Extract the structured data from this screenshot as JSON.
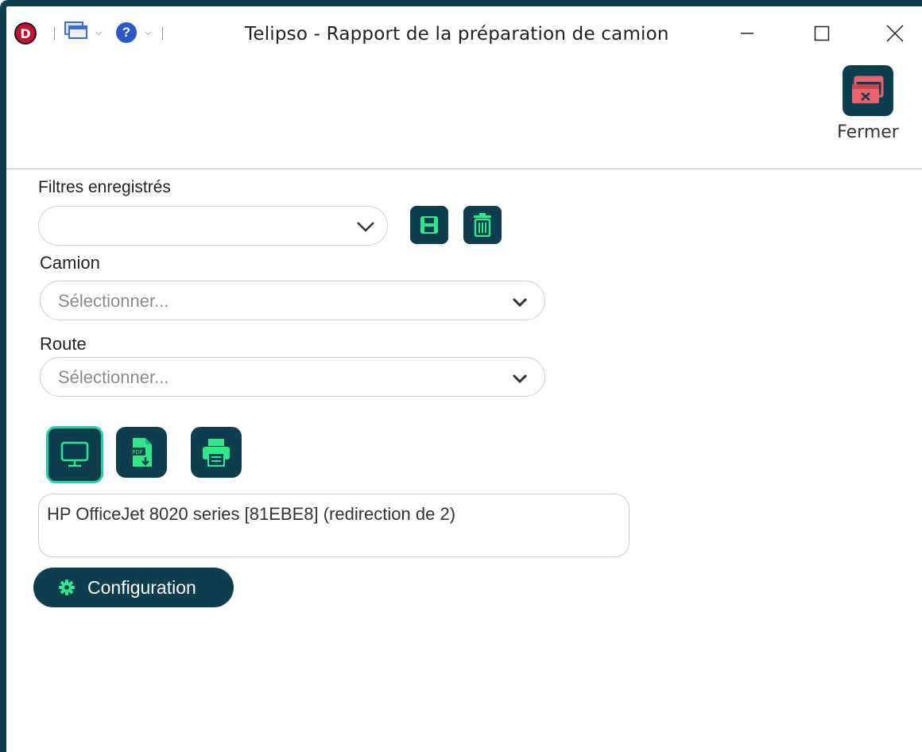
{
  "window": {
    "title": "Telipso - Rapport de la préparation de camion",
    "logo_letter": "D",
    "help_glyph": "?"
  },
  "toolbar": {
    "close_label": "Fermer"
  },
  "form": {
    "saved_filters": {
      "label": "Filtres enregistrés",
      "value": ""
    },
    "camion": {
      "label": "Camion",
      "placeholder": "Sélectionner..."
    },
    "route": {
      "label": "Route",
      "placeholder": "Sélectionner..."
    }
  },
  "output": {
    "printer_name": "HP OfficeJet 8020 series [81EBE8] (redirection de 2)",
    "config_label": "Configuration"
  },
  "colors": {
    "primary": "#0e3d4d",
    "accent_green": "#2ee88a",
    "accent_teal": "#1fd1a8",
    "close_icon_red": "#e8636b"
  },
  "icons": {
    "logo": "app-logo-icon",
    "windows": "windows-switch-icon",
    "help": "help-icon",
    "close_window": "close-window-icon",
    "save": "save-icon",
    "delete": "trash-icon",
    "screen": "monitor-icon",
    "pdf": "pdf-export-icon",
    "print": "printer-icon",
    "settings": "gear-icon"
  }
}
